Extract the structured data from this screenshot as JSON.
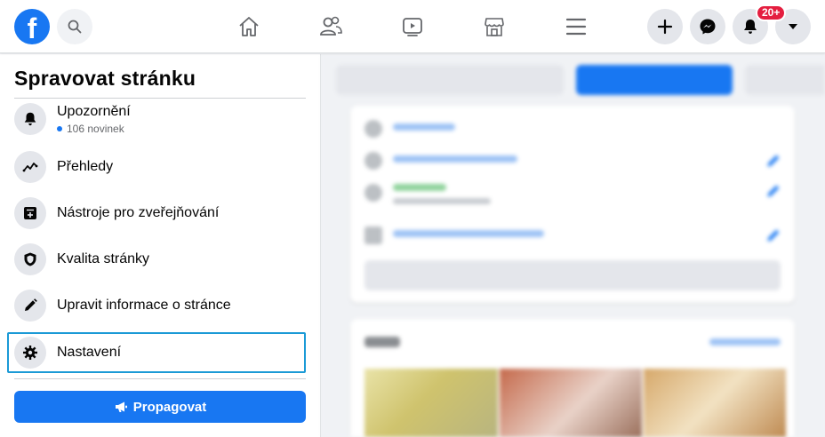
{
  "topbar": {
    "logo_letter": "f",
    "notification_badge": "20+",
    "icons": [
      "facebook-logo",
      "search-icon",
      "home-icon",
      "friends-icon",
      "watch-icon",
      "marketplace-icon",
      "menu-icon",
      "plus-icon",
      "messenger-icon",
      "bell-icon",
      "caret-down-icon"
    ]
  },
  "sidebar": {
    "title": "Spravovat stránku",
    "items": [
      {
        "label": "Upozornění",
        "sub": "106 novinek",
        "icon": "bell-icon"
      },
      {
        "label": "Přehledy",
        "icon": "insights-icon"
      },
      {
        "label": "Nástroje pro zveřejňování",
        "icon": "publishing-tools-icon"
      },
      {
        "label": "Kvalita stránky",
        "icon": "shield-icon"
      },
      {
        "label": "Upravit informace o stránce",
        "icon": "pencil-icon"
      },
      {
        "label": "Nastavení",
        "icon": "gear-icon",
        "active": true
      }
    ],
    "promote_label": "Propagovat"
  },
  "colors": {
    "brand_blue": "#1877f2",
    "highlight_border": "#1b9ad6",
    "badge_red": "#e41e3f"
  }
}
